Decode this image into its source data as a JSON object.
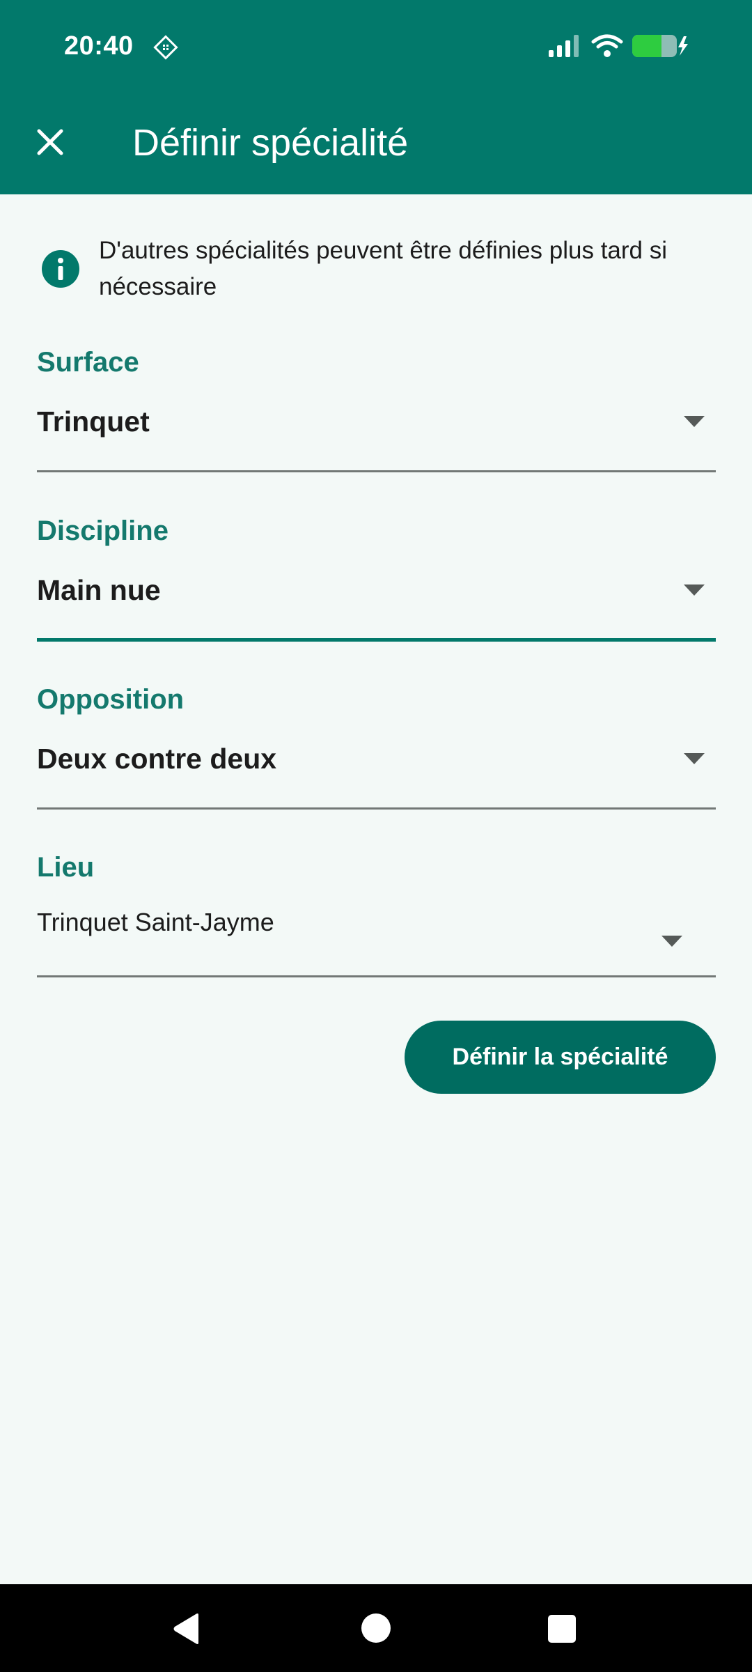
{
  "status_bar": {
    "time": "20:40",
    "battery_color": "#2ecc40",
    "icons": [
      "dnd-icon",
      "signal-icon",
      "wifi-icon",
      "battery-charging-icon"
    ]
  },
  "app_bar": {
    "title": "Définir spécialité",
    "close_icon": "close-icon",
    "background": "#02796b"
  },
  "info": {
    "icon": "info-icon",
    "text": "D'autres spécialités peuvent être définies plus tard si nécessaire"
  },
  "fields": {
    "surface": {
      "label": "Surface",
      "value": "Trinquet"
    },
    "discipline": {
      "label": "Discipline",
      "value": "Main nue",
      "focused": true
    },
    "opposition": {
      "label": "Opposition",
      "value": "Deux contre deux"
    },
    "lieu": {
      "label": "Lieu",
      "value": "Trinquet Saint-Jayme"
    }
  },
  "submit": {
    "label": "Définir la spécialité",
    "color": "#006c60"
  },
  "nav_bar": {
    "icons": [
      "back-icon",
      "home-icon",
      "recents-icon"
    ]
  },
  "colors": {
    "accent": "#14796d",
    "background": "#f3f9f7",
    "underline": "#727876"
  }
}
